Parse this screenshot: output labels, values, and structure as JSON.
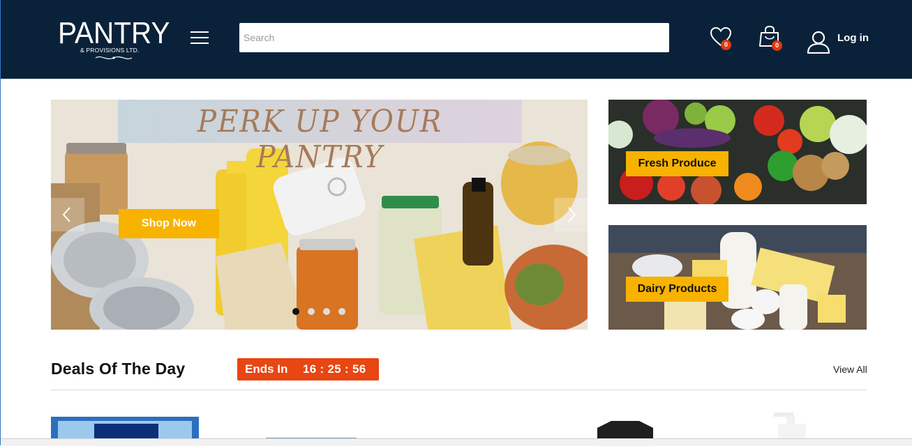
{
  "header": {
    "logo": {
      "main": "PANTRY",
      "sub": "& PROVISIONS LTD."
    },
    "search": {
      "placeholder": "Search",
      "value": ""
    },
    "wishlist": {
      "icon": "heart-icon",
      "count": "0"
    },
    "cart": {
      "icon": "shopping-bag-icon",
      "count": "0"
    },
    "account": {
      "icon": "user-icon",
      "label": "Log in"
    },
    "menu_icon": "hamburger-icon"
  },
  "hero": {
    "headline": "PERK UP YOUR PANTRY",
    "cta_label": "Shop Now",
    "slides_total": 4,
    "active_slide": 1
  },
  "promos": [
    {
      "label": "Fresh Produce"
    },
    {
      "label": "Dairy Products"
    }
  ],
  "deals": {
    "title": "Deals Of The Day",
    "timer_label": "Ends In",
    "timer_value": "16 : 25 : 56",
    "view_all": "View All"
  },
  "colors": {
    "header_bg": "#0a2239",
    "accent_yellow": "#f8b200",
    "timer_orange": "#e84612",
    "badge_red": "#e03a12"
  }
}
